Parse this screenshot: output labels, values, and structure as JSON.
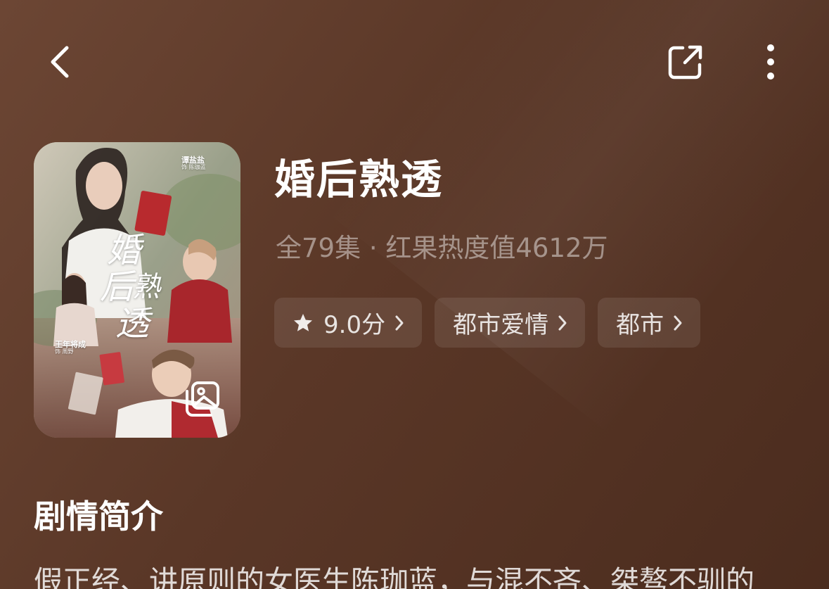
{
  "topbar": {
    "back_icon": "chevron-left-icon",
    "share_icon": "share-icon",
    "more_icon": "more-vertical-icon"
  },
  "poster": {
    "title_chars": [
      "婚",
      "后",
      "熟",
      "透"
    ],
    "credit_top": {
      "name": "谭盐盐",
      "role": "饰 陈珈蓝"
    },
    "credit_bottom": {
      "name": "王年将成",
      "role": "饰 周野"
    },
    "gallery_icon": "gallery-icon"
  },
  "show": {
    "title": "婚后熟透",
    "meta": "全79集 · 红果热度值4612万"
  },
  "tags": [
    {
      "label": "9.0分",
      "icon": "star-icon"
    },
    {
      "label": "都市爱情"
    },
    {
      "label": "都市"
    }
  ],
  "synopsis": {
    "heading": "剧情简介",
    "text": "假正经、讲原则的女医生陈珈蓝，与混不吝、桀骜不驯的"
  },
  "colors": {
    "background": "#5a3727",
    "tag_background": "rgba(255,255,255,0.09)",
    "meta_text": "rgba(255,255,255,0.45)"
  }
}
